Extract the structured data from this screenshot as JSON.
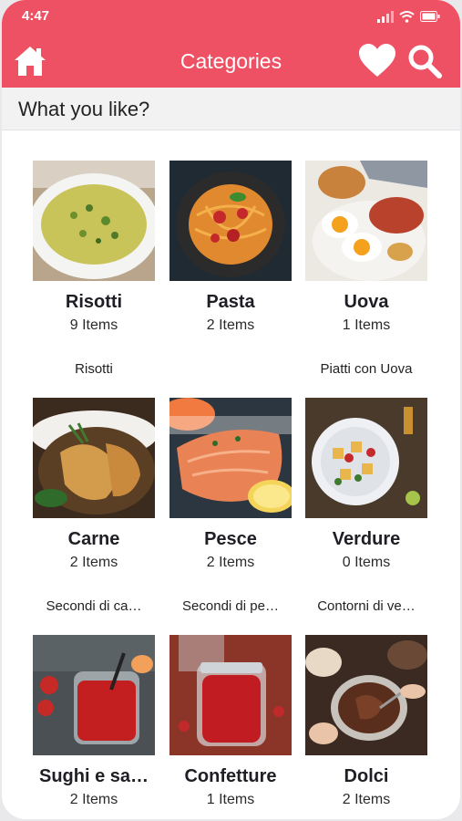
{
  "status": {
    "time": "4:47"
  },
  "appbar": {
    "title": "Categories",
    "icons": [
      "home-icon",
      "heart-icon",
      "search-icon"
    ]
  },
  "subheader": {
    "text": "What you like?"
  },
  "colors": {
    "accent": "#ef5164",
    "subheader_bg": "#f2f2f3"
  },
  "categories": [
    {
      "name": "Risotti",
      "count": "9 Items",
      "description": "Risotti",
      "image": "risotto"
    },
    {
      "name": "Pasta",
      "count": "2 Items",
      "description": "",
      "image": "pasta"
    },
    {
      "name": "Uova",
      "count": "1 Items",
      "description": "Piatti con Uova",
      "image": "eggs"
    },
    {
      "name": "Carne",
      "count": "2 Items",
      "description": "Secondi di ca…",
      "image": "chicken"
    },
    {
      "name": "Pesce",
      "count": "2 Items",
      "description": "Secondi di pe…",
      "image": "salmon"
    },
    {
      "name": "Verdure",
      "count": "0 Items",
      "description": "Contorni di ve…",
      "image": "vegetables"
    },
    {
      "name": "Sughi e sa…",
      "count": "2 Items",
      "description": "",
      "image": "tomato-sauce"
    },
    {
      "name": "Confetture",
      "count": "1 Items",
      "description": "",
      "image": "jam-jar"
    },
    {
      "name": "Dolci",
      "count": "2 Items",
      "description": "",
      "image": "chocolate-cream"
    }
  ]
}
